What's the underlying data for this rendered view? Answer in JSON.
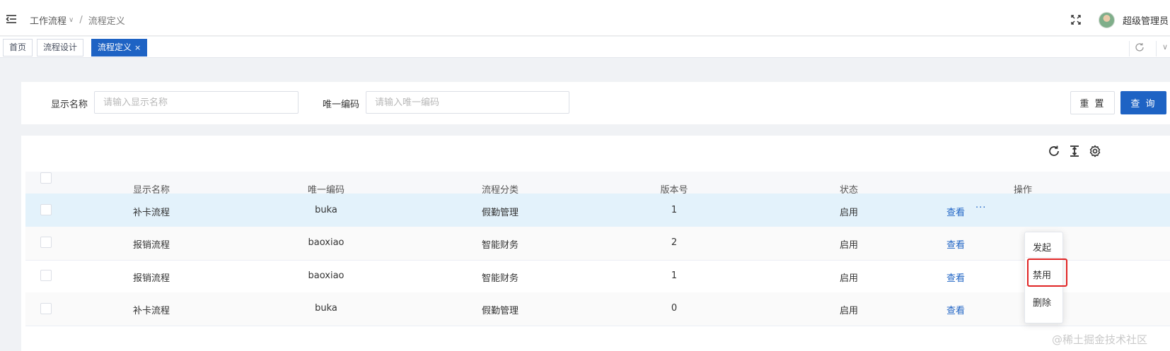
{
  "header": {
    "breadcrumb": [
      "工作流程",
      "流程定义"
    ],
    "username": "超级管理员"
  },
  "tabs": [
    {
      "label": "首页",
      "active": false
    },
    {
      "label": "流程设计",
      "active": false
    },
    {
      "label": "流程定义",
      "active": true,
      "close": "×"
    }
  ],
  "search": {
    "name_label": "显示名称",
    "name_placeholder": "请输入显示名称",
    "code_label": "唯一编码",
    "code_placeholder": "请输入唯一编码",
    "reset": "重 置",
    "search": "查 询"
  },
  "table": {
    "columns": [
      "显示名称",
      "唯一编码",
      "流程分类",
      "版本号",
      "状态",
      "操作"
    ],
    "rows": [
      {
        "name": "补卡流程",
        "code": "buka",
        "category": "假勤管理",
        "version": "1",
        "status": "启用",
        "action": "查看",
        "more": "···"
      },
      {
        "name": "报销流程",
        "code": "baoxiao",
        "category": "智能财务",
        "version": "2",
        "status": "启用",
        "action": "查看",
        "more": ""
      },
      {
        "name": "报销流程",
        "code": "baoxiao",
        "category": "智能财务",
        "version": "1",
        "status": "启用",
        "action": "查看",
        "more": ""
      },
      {
        "name": "补卡流程",
        "code": "buka",
        "category": "假勤管理",
        "version": "0",
        "status": "启用",
        "action": "查看",
        "more": ""
      }
    ]
  },
  "dropdown": [
    "发起",
    "禁用",
    "删除"
  ],
  "watermark": "@稀土掘金技术社区",
  "colors": {
    "primary": "#1e63c4",
    "highlight_row": "#e3f2fb",
    "annotation": "#e02424"
  }
}
